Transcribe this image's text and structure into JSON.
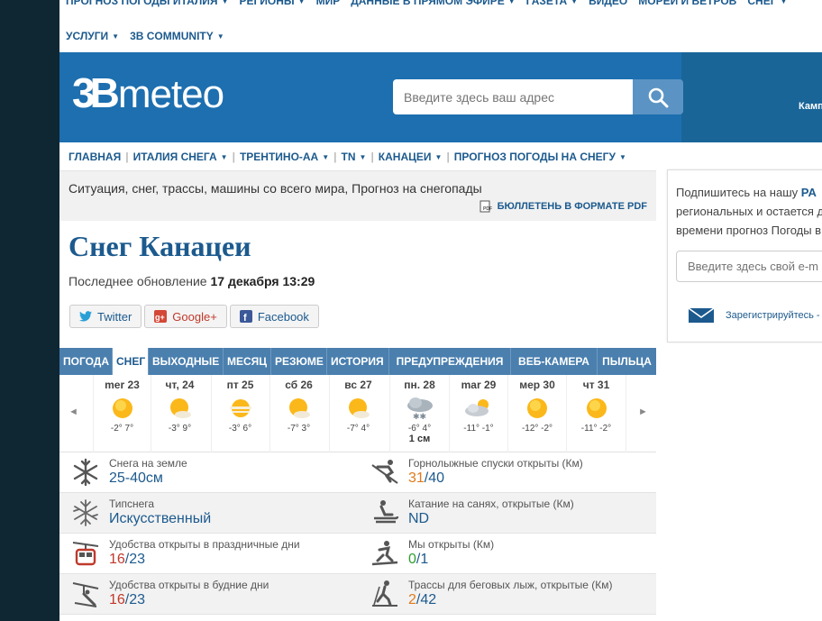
{
  "topnav": {
    "row1": [
      "ПРОГНОЗ ПОГОДЫ ИТАЛИЯ",
      "РЕГИОНЫ",
      "МИР",
      "ДАННЫЕ В ПРЯМОМ ЭФИРЕ",
      "ГАЗЕТА",
      "ВИДЕО",
      "МОРЕЙ И ВЕТРОВ",
      "СНЕГ"
    ],
    "row2": [
      "УСЛУГИ",
      "3B COMMUNITY"
    ]
  },
  "logo": {
    "mark": "3B",
    "word": "meteo"
  },
  "search": {
    "placeholder": "Введите здесь ваш адрес"
  },
  "banner_text": "Камп",
  "subnav": [
    "ГЛАВНАЯ",
    "ИТАЛИЯ СНЕГА",
    "ТРЕНТИНО-АА",
    "TN",
    "КАНАЦЕИ",
    "ПРОГНОЗ ПОГОДЫ НА СНЕГУ"
  ],
  "intro": {
    "text": "Ситуация, снег, трассы, машины со всего мира, Прогноз на снегопады",
    "pdf": "БЮЛЛЕТЕНЬ В ФОРМАТЕ PDF"
  },
  "title": "Снег Канацеи",
  "updated": {
    "prefix": "Последнее обновление",
    "value": "17 декабря 13:29"
  },
  "share": {
    "twitter": "Twitter",
    "google": "Google+",
    "facebook": "Facebook"
  },
  "tabs": [
    "ПОГОДА",
    "СНЕГ",
    "ВЫХОДНЫЕ",
    "МЕСЯЦ",
    "РЕЗЮМЕ",
    "ИСТОРИЯ",
    "ПРЕДУПРЕЖДЕНИЯ",
    "ВЕБ-КАМЕРА",
    "ПЫЛЬЦА"
  ],
  "active_tab": "СНЕГ",
  "days": [
    {
      "name": "mer 23",
      "temp": "-2° 7°",
      "icon": "sun-icon"
    },
    {
      "name": "чт, 24",
      "temp": "-3° 9°",
      "icon": "sun-cloud-icon"
    },
    {
      "name": "пт 25",
      "temp": "-3° 6°",
      "icon": "sun-haze-icon"
    },
    {
      "name": "сб 26",
      "temp": "-7° 3°",
      "icon": "sun-cloud-icon"
    },
    {
      "name": "вс 27",
      "temp": "-7° 4°",
      "icon": "sun-cloud-icon"
    },
    {
      "name": "пн. 28",
      "temp": "-6° 4°",
      "icon": "snow-cloud-icon",
      "snow": "1 см"
    },
    {
      "name": "mar 29",
      "temp": "-11° -1°",
      "icon": "cloud-sun-icon"
    },
    {
      "name": "мер 30",
      "temp": "-12° -2°",
      "icon": "sun-icon"
    },
    {
      "name": "чт 31",
      "temp": "-11° -2°",
      "icon": "sun-icon"
    }
  ],
  "nav_arrows": {
    "prev": "◄",
    "next": "►"
  },
  "stats": {
    "snow_ground": {
      "label": "Снега на земле",
      "value": "25-40см"
    },
    "slopes": {
      "label": "Горнолыжные спуски открыты (Км)",
      "open": "31",
      "total": "40"
    },
    "snow_type": {
      "label": "Типснега",
      "value": "Искусственный"
    },
    "sled": {
      "label": "Катание на санях, открытые (Км)",
      "value": "ND"
    },
    "lifts_holiday": {
      "label": "Удобства открыты в праздничные дни",
      "open": "16",
      "total": "23"
    },
    "we_open": {
      "label": "Мы открыты (Км)",
      "open": "0",
      "total": "1"
    },
    "lifts_weekday": {
      "label": "Удобства открыты в будние дни",
      "open": "16",
      "total": "23"
    },
    "crosscountry": {
      "label": "Трассы для беговых лыж, открытые (Км)",
      "open": "2",
      "total": "42"
    }
  },
  "sidebar": {
    "text_prefix": "Подпишитесь на нашу",
    "text_bold": "PA",
    "text_rest": "региональных и остается д времени прогноз Погоды в",
    "email_placeholder": "Введите здесь свой e-m",
    "register": "Зарегистрируйтесь -"
  },
  "colors": {
    "brand": "#1d6faf",
    "link": "#1c5a8e",
    "orange": "#e07b1c",
    "green": "#2f9e2f",
    "red": "#c0392b"
  }
}
